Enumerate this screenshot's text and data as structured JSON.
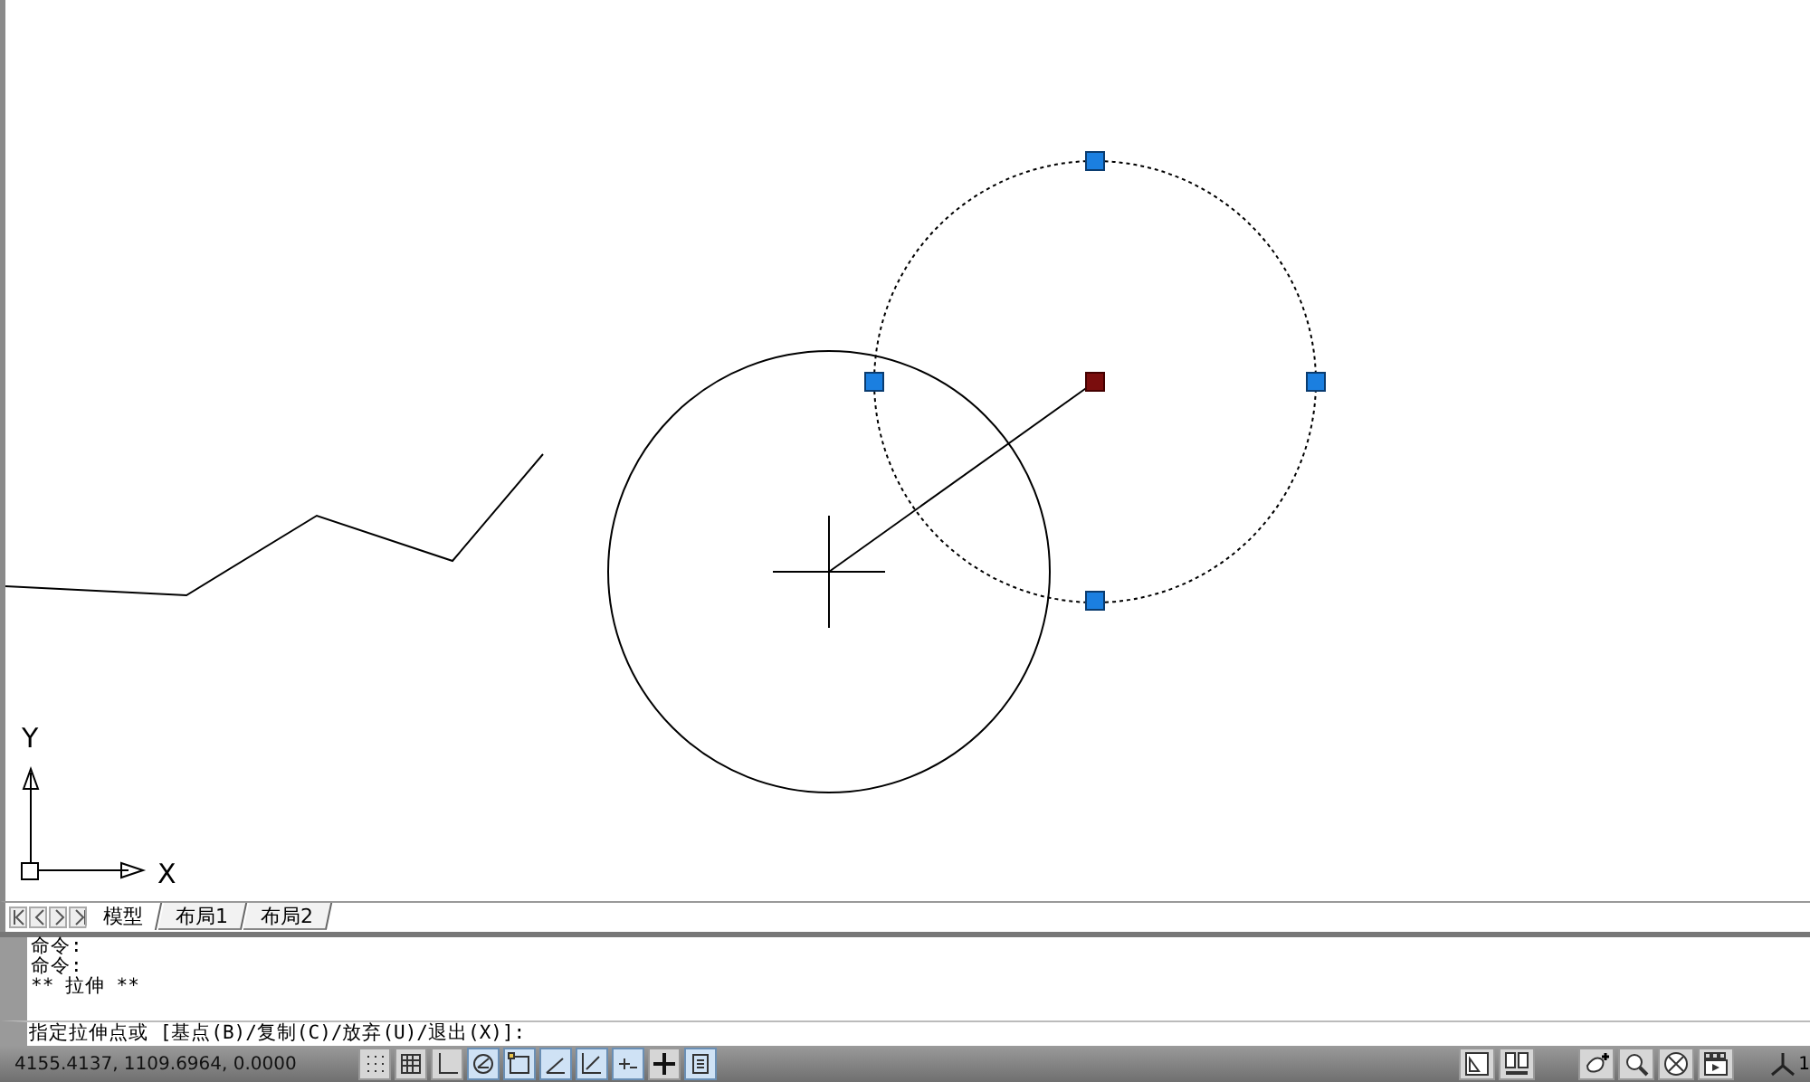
{
  "drawing": {
    "axis_labels": {
      "x": "X",
      "y": "Y"
    }
  },
  "layout_tabs": [
    {
      "label": "模型",
      "selected": true
    },
    {
      "label": "布局1",
      "selected": false
    },
    {
      "label": "布局2",
      "selected": false
    }
  ],
  "command_history": [
    "命令:",
    "命令:",
    "** 拉伸 **"
  ],
  "command_prompt": "指定拉伸点或 [基点(B)/复制(C)/放弃(U)/退出(X)]:",
  "status_bar": {
    "coordinates": "4155.4137, 1109.6964, 0.0000",
    "toggles": [
      {
        "kind": "snap",
        "on": false
      },
      {
        "kind": "grid",
        "on": false
      },
      {
        "kind": "ortho",
        "on": false
      },
      {
        "kind": "polar",
        "on": true
      },
      {
        "kind": "osnap",
        "on": true
      },
      {
        "kind": "otrack",
        "on": true
      },
      {
        "kind": "ducs",
        "on": true
      },
      {
        "kind": "dyn",
        "on": true
      },
      {
        "kind": "lwt",
        "on": false
      },
      {
        "kind": "qp",
        "on": true
      }
    ],
    "annotation_scale": "1"
  }
}
